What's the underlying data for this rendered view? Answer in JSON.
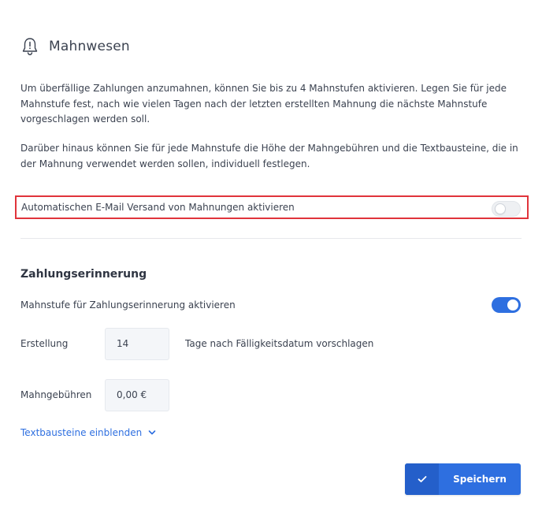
{
  "header": {
    "title": "Mahnwesen",
    "icon": "bell-icon"
  },
  "intro": {
    "paragraph1": "Um überfällige Zahlungen anzumahnen, können Sie bis zu 4 Mahnstufen aktivieren. Legen Sie für jede Mahnstufe fest, nach wie vielen Tagen nach der letzten erstellten Mahnung die nächste Mahnstufe vorgeschlagen werden soll.",
    "paragraph2": "Darüber hinaus können Sie für jede Mahnstufe die Höhe der Mahngebühren und die Textbausteine, die in der Mahnung verwendet werden sollen, individuell festlegen."
  },
  "email_setting": {
    "label": "Automatischen E-Mail Versand von Mahnungen aktivieren",
    "enabled": false,
    "highlight_color": "#e0343b"
  },
  "reminder": {
    "section_title": "Zahlungserinnerung",
    "activate_label": "Mahnstufe für Zahlungserinnerung aktivieren",
    "activate_enabled": true,
    "creation_label": "Erstellung",
    "creation_value": "14",
    "creation_suffix": "Tage nach Fälligkeitsdatum vorschlagen",
    "fee_label": "Mahngebühren",
    "fee_value": "0,00 €",
    "textblocks_link": "Textbausteine einblenden"
  },
  "actions": {
    "save_label": "Speichern",
    "save_icon": "check-icon"
  },
  "colors": {
    "accent": "#2e6fe0",
    "accent_dark": "#245fca",
    "text": "#3b4250"
  }
}
